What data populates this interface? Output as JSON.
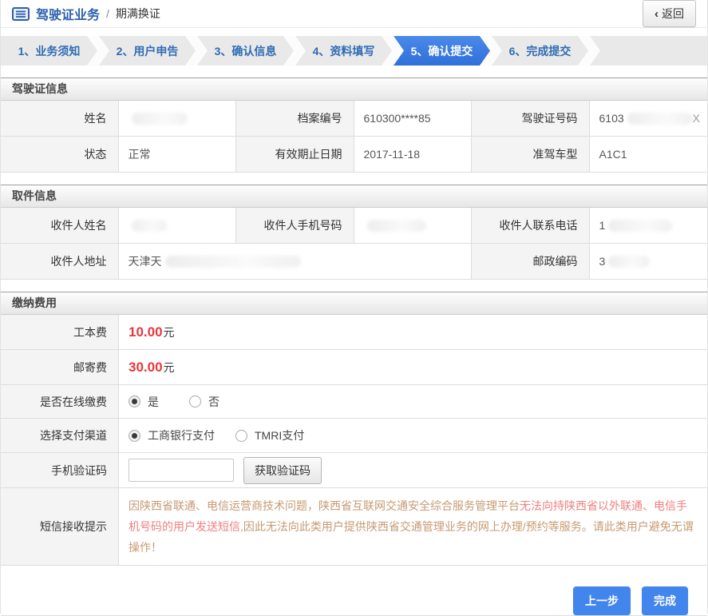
{
  "header": {
    "title_primary": "驾驶证业务",
    "title_separator": "/",
    "title_secondary": "期满换证",
    "back_chevron": "‹",
    "back_label": "返回"
  },
  "steps": [
    {
      "label": "1、业务须知"
    },
    {
      "label": "2、用户申告"
    },
    {
      "label": "3、确认信息"
    },
    {
      "label": "4、资料填写"
    },
    {
      "label": "5、确认提交"
    },
    {
      "label": "6、完成提交"
    }
  ],
  "active_step": "5、确认提交",
  "active_step_index": 4,
  "license_section": {
    "title": "驾驶证信息",
    "name_label": "姓名",
    "name_value": "",
    "file_no_label": "档案编号",
    "file_no_value": "610300****85",
    "license_no_label": "驾驶证号码",
    "license_no_prefix": "6103",
    "license_no_suffix": "X",
    "status_label": "状态",
    "status_value": "正常",
    "expiry_label": "有效期止日期",
    "expiry_value": "2017-11-18",
    "vehicle_class_label": "准驾车型",
    "vehicle_class_value": "A1C1"
  },
  "pickup_section": {
    "title": "取件信息",
    "recipient_name_label": "收件人姓名",
    "recipient_name_value": "",
    "recipient_mobile_label": "收件人手机号码",
    "recipient_mobile_value": "",
    "recipient_phone_label": "收件人联系电话",
    "recipient_phone_prefix": "1",
    "address_label": "收件人地址",
    "address_prefix": "天津天",
    "postcode_label": "邮政编码",
    "postcode_prefix": "3"
  },
  "fees_section": {
    "title": "缴纳费用",
    "work_fee_label": "工本费",
    "work_fee_amount": "10.00",
    "work_fee_unit": "元",
    "post_fee_label": "邮寄费",
    "post_fee_amount": "30.00",
    "post_fee_unit": "元",
    "online_pay_label": "是否在线缴费",
    "online_pay_yes": "是",
    "online_pay_no": "否",
    "online_pay_selected": "是",
    "channel_label": "选择支付渠道",
    "channel_icbc": "工商银行支付",
    "channel_tmri": "TMRI支付",
    "channel_selected": "工商银行支付",
    "sms_code_label": "手机验证码",
    "sms_code_value": "",
    "sms_code_button": "获取验证码",
    "sms_note_label": "短信接收提示",
    "sms_note_part1": "因陕西省联通、电信运营商技术问题，陕西省互联网交通安全综合服务管理平台",
    "sms_note_emphasis": "无法向持陕西省以外联通、电信手机号码的用户发送短信",
    "sms_note_part2": ",因此无法向此类用户提供陕西省交通管理业务的网上办理/预约等服务。请此类用户避免无谓操作！"
  },
  "footer": {
    "prev_label": "上一步",
    "finish_label": "完成"
  },
  "colors": {
    "top_bar_navy": "#173a6e",
    "accent_blue": "#2b5fad",
    "active_step_blue": "#3b7de0",
    "button_blue": "#4285ec",
    "price_red": "#e4393c",
    "note_tan": "#c79a72",
    "note_red": "#ef8080"
  }
}
